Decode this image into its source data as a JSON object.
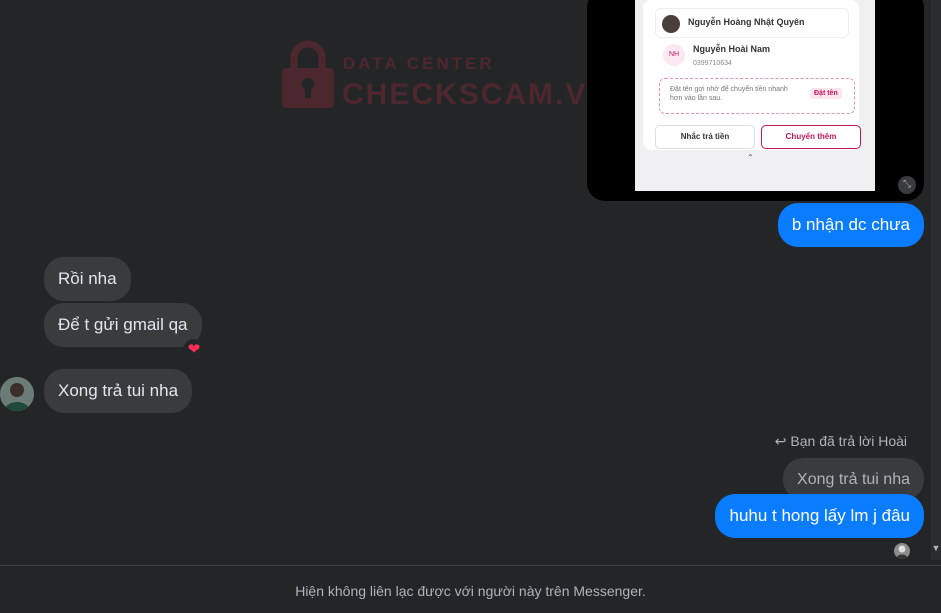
{
  "watermark": {
    "top_text": "DATA CENTER",
    "main_text": "CHECKSCAM.VN"
  },
  "attachment": {
    "payer_name": "Nguyễn Hoàng Nhật Quyên",
    "payee_initials": "NH",
    "payee_name": "Nguyễn Hoài Nam",
    "payee_phone": "0399710634",
    "nickname_hint": "Đặt tên gợi nhớ để chuyển tiền nhanh hơn vào lần sau.",
    "nickname_button": "Đặt tên",
    "remind_button": "Nhắc trả tiền",
    "transfer_button": "Chuyển thêm",
    "caret": "⌃",
    "expand_icon": "⤡"
  },
  "messages": [
    {
      "side": "out",
      "text": "b nhận dc chưa"
    },
    {
      "side": "in",
      "text": "Rồi nha"
    },
    {
      "side": "in",
      "text": "Để t gửi gmail qa",
      "reaction": "❤"
    },
    {
      "side": "in",
      "text": "Xong trả tui nha"
    }
  ],
  "reply": {
    "icon": "↩",
    "note": "Bạn đã trả lời Hoài",
    "quoted_text": "Xong trả tui nha",
    "message": "huhu t hong lấy lm j đâu"
  },
  "footer": {
    "notice": "Hiện không liên lạc được với người này trên Messenger."
  },
  "scroll_icon": "▼"
}
